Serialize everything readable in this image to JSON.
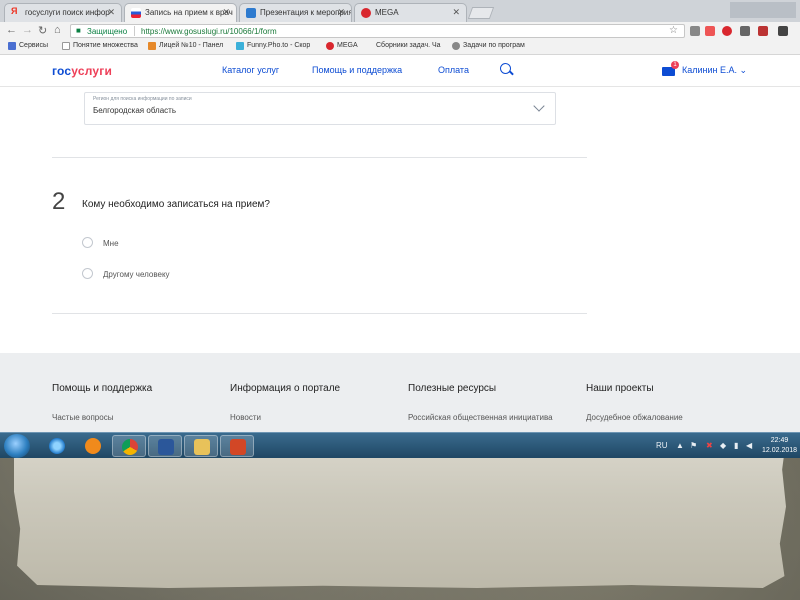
{
  "browser": {
    "tabs": [
      {
        "label": "госуслуги поиск инфор",
        "favicon_color": "#e32"
      },
      {
        "label": "Запись на прием к врач",
        "favicon_color": "#2a5bd7"
      },
      {
        "label": "Презентация к мероприя",
        "favicon_color": "#2e7bcf"
      },
      {
        "label": "MEGA",
        "favicon_color": "#d9272e"
      }
    ],
    "secure_label": "Защищено",
    "url": "https://www.gosuslugi.ru/10066/1/form",
    "bookmarks": [
      {
        "label": "Сервисы",
        "color": "#4a6fd1"
      },
      {
        "label": "Понятие множества",
        "color": "#777"
      },
      {
        "label": "Лицей №10 - Панел",
        "color": "#e6892a"
      },
      {
        "label": "Funny.Pho.to - Скор",
        "color": "#3bb0d9"
      },
      {
        "label": "MEGA",
        "color": "#d9272e"
      },
      {
        "label": "Сборники задач. Ча",
        "color": "#bbb"
      },
      {
        "label": "Задачи по програм",
        "color": "#888"
      }
    ]
  },
  "site": {
    "logo_gos": "гос",
    "logo_uslugi": "услуги",
    "nav": [
      "Каталог услуг",
      "Помощь и поддержка",
      "Оплата"
    ],
    "mail_badge": "1",
    "user_name": "Калинин Е.А."
  },
  "form": {
    "region_label": "Регион для поиска информации по записи",
    "region_value": "Белгородская область",
    "step_number": "2",
    "question": "Кому необходимо записаться на прием?",
    "options": [
      "Мне",
      "Другому человеку"
    ]
  },
  "footer": {
    "columns": [
      {
        "heading": "Помощь и поддержка",
        "link": "Частые вопросы"
      },
      {
        "heading": "Информация о портале",
        "link": "Новости"
      },
      {
        "heading": "Полезные ресурсы",
        "link": "Российская общественная инициатива"
      },
      {
        "heading": "Наши проекты",
        "link": "Досудебное обжалование"
      }
    ]
  },
  "taskbar": {
    "language": "RU",
    "time": "22:49",
    "date": "12.02.2018"
  }
}
